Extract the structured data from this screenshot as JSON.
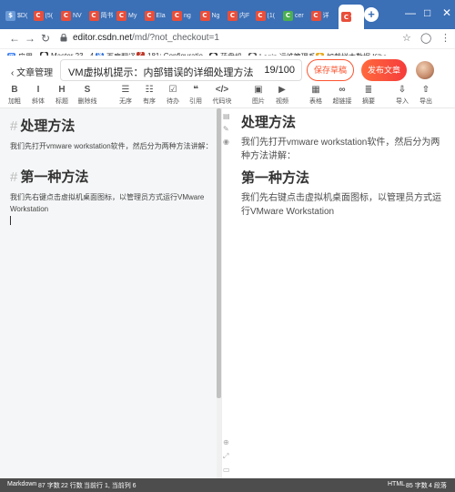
{
  "browser": {
    "tabs": [
      {
        "label": "$D(",
        "color": "#6b9bd8",
        "glyph": "$"
      },
      {
        "label": "(5(",
        "color": "#e94e3a",
        "glyph": "C"
      },
      {
        "label": "NV",
        "color": "#e94e3a",
        "glyph": "C"
      },
      {
        "label": "简书",
        "color": "#e94e3a",
        "glyph": "C"
      },
      {
        "label": "My",
        "color": "#e94e3a",
        "glyph": "C"
      },
      {
        "label": "Ela",
        "color": "#e94e3a",
        "glyph": "C"
      },
      {
        "label": "ng",
        "color": "#e94e3a",
        "glyph": "C"
      },
      {
        "label": "Ng",
        "color": "#e94e3a",
        "glyph": "C"
      },
      {
        "label": "内F",
        "color": "#e94e3a",
        "glyph": "C"
      },
      {
        "label": "(1(",
        "color": "#e94e3a",
        "glyph": "C"
      },
      {
        "label": "cer",
        "color": "#4caf50",
        "glyph": "C"
      },
      {
        "label": "详",
        "color": "#e94e3a",
        "glyph": "C"
      },
      {
        "label": "",
        "color": "#e94e3a",
        "glyph": "C"
      }
    ],
    "new_tab": "+",
    "minimize": "—",
    "url_host": "editor.csdn.net",
    "url_path": "/md/?not_checkout=1",
    "bookmarks": [
      {
        "label": "应用",
        "color": "#4285f4",
        "glyph": "⊞"
      },
      {
        "label": "Master 23 · 4",
        "color": "#333333",
        "glyph": "⬤"
      },
      {
        "label": "百度翻译",
        "color": "#2b6ed8",
        "glyph": "译"
      },
      {
        "label": "181: Configuratio...",
        "color": "#c0392b",
        "glyph": "Z"
      },
      {
        "label": "蓝盘机",
        "color": "#333333",
        "glyph": "⬤"
      },
      {
        "label": "Login 运维管理系统",
        "color": "#555555",
        "glyph": "⬤"
      },
      {
        "label": "加载样本数据 Kiba...",
        "color": "#e6a91a",
        "glyph": "✱"
      }
    ]
  },
  "editor": {
    "back_label": "文章管理",
    "title": "VM虚拟机提示：内部错误的详细处理方法",
    "title_count": "19/100",
    "save_label": "保存草稿",
    "publish_label": "发布文章"
  },
  "toolbar": [
    {
      "icon": "B",
      "label": "加粗",
      "name": "bold-icon"
    },
    {
      "icon": "I",
      "label": "斜体",
      "name": "italic-icon"
    },
    {
      "icon": "H",
      "label": "标题",
      "name": "heading-icon"
    },
    {
      "icon": "S",
      "label": "删除线",
      "name": "strikethrough-icon"
    },
    {
      "icon": "☰",
      "label": "无序",
      "name": "unordered-list-icon"
    },
    {
      "icon": "☷",
      "label": "有序",
      "name": "ordered-list-icon"
    },
    {
      "icon": "☑",
      "label": "待办",
      "name": "todo-icon"
    },
    {
      "icon": "❝",
      "label": "引用",
      "name": "quote-icon"
    },
    {
      "icon": "</>",
      "label": "代码块",
      "name": "code-block-icon"
    },
    {
      "icon": "▣",
      "label": "图片",
      "name": "image-icon"
    },
    {
      "icon": "▶",
      "label": "视频",
      "name": "video-icon"
    },
    {
      "icon": "▦",
      "label": "表格",
      "name": "table-icon"
    },
    {
      "icon": "∞",
      "label": "超链接",
      "name": "link-icon"
    },
    {
      "icon": "≣",
      "label": "摘要",
      "name": "summary-icon"
    },
    {
      "icon": "⇩",
      "label": "导入",
      "name": "import-icon"
    },
    {
      "icon": "⇧",
      "label": "导出",
      "name": "export-icon"
    }
  ],
  "markdown": {
    "h1_a": "处理方法",
    "p_a": "我们先打开vmware workstation软件，然后分为两种方法讲解：",
    "h1_b": "第一种方法",
    "p_b": "我们先右键点击虚拟机桌面图标，以管理员方式运行VMware Workstation",
    "hash": "#"
  },
  "preview": {
    "h1_a": "处理方法",
    "p_a": "我们先打开vmware workstation软件，然后分为两种方法讲解：",
    "h1_b": "第一种方法",
    "p_b": "我们先右键点击虚拟机桌面图标，以管理员方式运行VMware Workstation"
  },
  "status": {
    "mode": "Markdown",
    "words": "87 字数",
    "lines": "22 行数",
    "cursor": "当前行 1, 当前列 6",
    "html_mode": "HTML",
    "html_words": "85 字数",
    "paragraphs": "4 段落"
  }
}
